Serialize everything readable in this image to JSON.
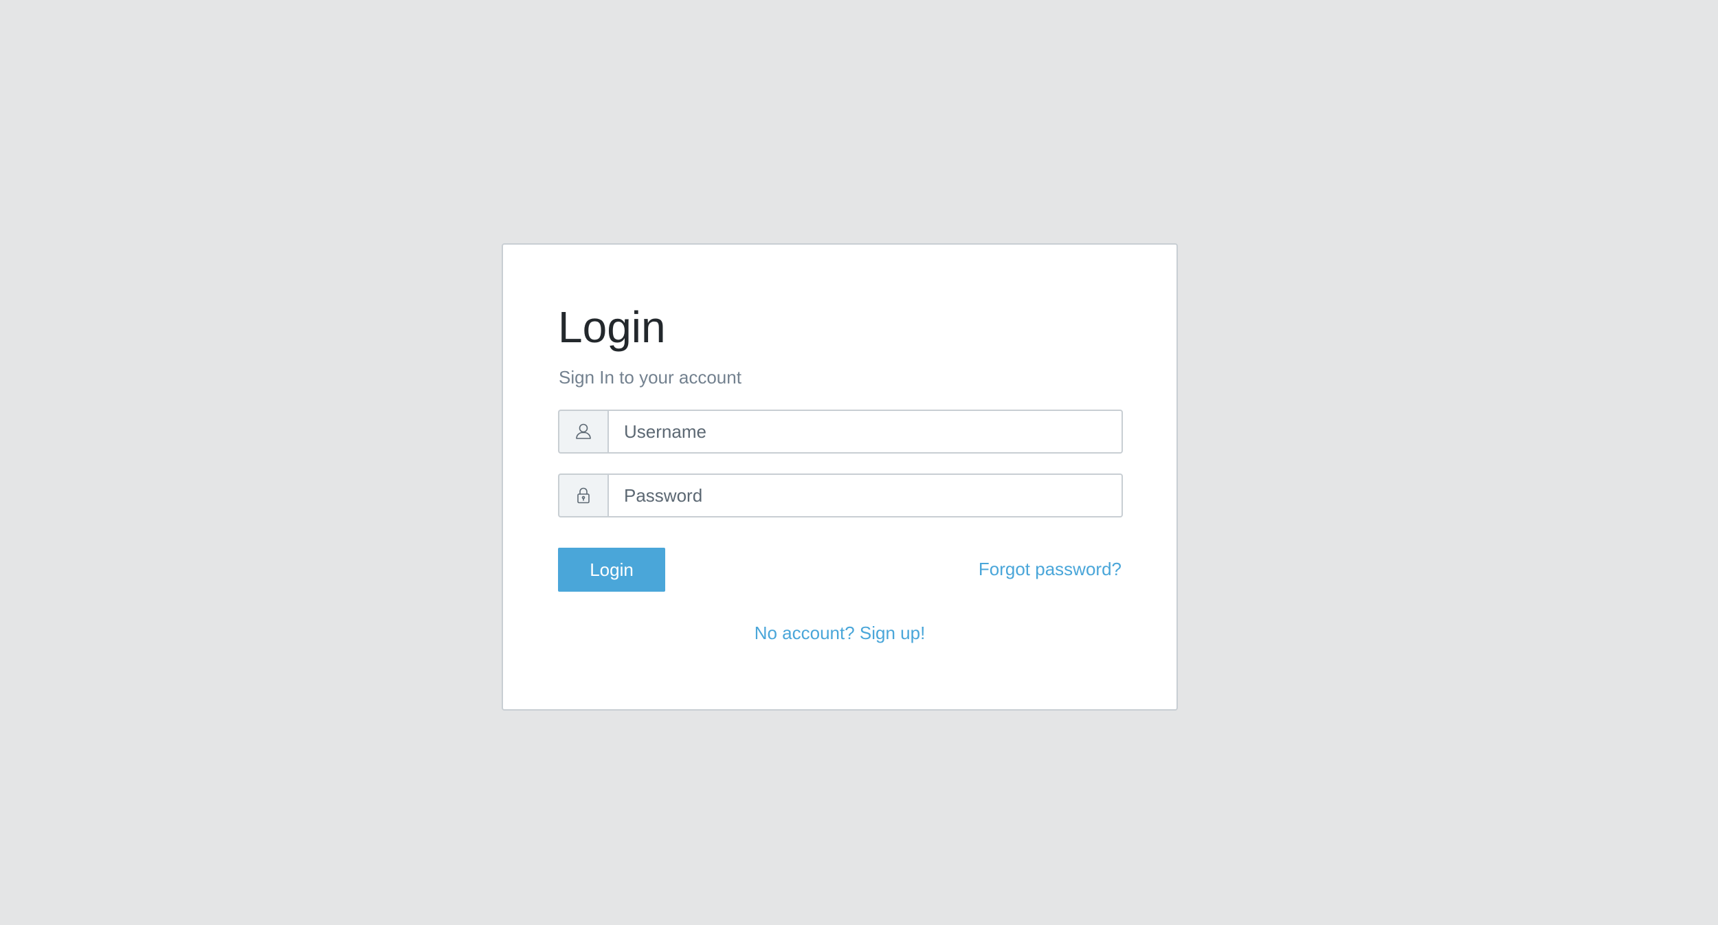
{
  "login_card": {
    "title": "Login",
    "subtitle": "Sign In to your account",
    "username": {
      "icon": "user-icon",
      "placeholder": "Username",
      "value": ""
    },
    "password": {
      "icon": "lock-icon",
      "placeholder": "Password",
      "value": ""
    },
    "login_button_label": "Login",
    "forgot_password_label": "Forgot password?",
    "signup_label": "No account? Sign up!"
  },
  "colors": {
    "page_background": "#e4e5e6",
    "card_background": "#ffffff",
    "accent": "#4aa6d9",
    "title_text": "#23282c",
    "muted_text": "#73818f",
    "border": "#c8ced3",
    "addon_background": "#f0f3f5"
  }
}
